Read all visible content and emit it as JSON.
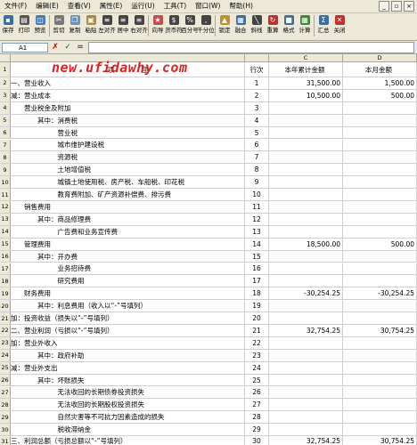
{
  "menu": [
    {
      "label": "文件(F)",
      "name": "menu-file"
    },
    {
      "label": "编辑(E)",
      "name": "menu-edit"
    },
    {
      "label": "查看(V)",
      "name": "menu-view"
    },
    {
      "label": "属性(E)",
      "name": "menu-properties"
    },
    {
      "label": "运行(U)",
      "name": "menu-run"
    },
    {
      "label": "工具(T)",
      "name": "menu-tools"
    },
    {
      "label": "窗口(W)",
      "name": "menu-window"
    },
    {
      "label": "帮助(H)",
      "name": "menu-help"
    }
  ],
  "toolbar": [
    {
      "label": "保存",
      "name": "save-button",
      "icon": "save-icon",
      "color": "#3a6ea5"
    },
    {
      "label": "打印",
      "name": "print-button",
      "icon": "printer-icon",
      "color": "#555555"
    },
    {
      "label": "预览",
      "name": "preview-button",
      "icon": "preview-icon",
      "color": "#4a7ab0"
    },
    {
      "sep": true
    },
    {
      "label": "剪切",
      "name": "cut-button",
      "icon": "scissors-icon",
      "color": "#777777"
    },
    {
      "label": "复制",
      "name": "copy-button",
      "icon": "copy-icon",
      "color": "#6a8fc0"
    },
    {
      "label": "粘贴",
      "name": "paste-button",
      "icon": "paste-icon",
      "color": "#b08a3a"
    },
    {
      "label": "左对齐",
      "name": "align-left-button",
      "icon": "align-left-icon",
      "color": "#444444"
    },
    {
      "label": "居中",
      "name": "align-center-button",
      "icon": "align-center-icon",
      "color": "#444444"
    },
    {
      "label": "右对齐",
      "name": "align-right-button",
      "icon": "align-right-icon",
      "color": "#444444"
    },
    {
      "sep": true
    },
    {
      "label": "向导",
      "name": "wizard-button",
      "icon": "wizard-icon",
      "color": "#c05050"
    },
    {
      "label": "货币符",
      "name": "currency-button",
      "icon": "currency-icon",
      "color": "#444444"
    },
    {
      "label": "百分号",
      "name": "percent-button",
      "icon": "percent-icon",
      "color": "#444444"
    },
    {
      "label": "千分位",
      "name": "thousands-button",
      "icon": "thousands-icon",
      "color": "#444444"
    },
    {
      "sep": true
    },
    {
      "label": "锁定",
      "name": "lock-button",
      "icon": "lock-icon",
      "color": "#c09030"
    },
    {
      "label": "融合",
      "name": "merge-button",
      "icon": "merge-icon",
      "color": "#3a6ea5"
    },
    {
      "label": "斜线",
      "name": "diagonal-button",
      "icon": "diagonal-icon",
      "color": "#444444"
    },
    {
      "label": "重算",
      "name": "recalc-button",
      "icon": "recalc-icon",
      "color": "#c03030"
    },
    {
      "label": "格式",
      "name": "format-button",
      "icon": "format-icon",
      "color": "#3a6ea5"
    },
    {
      "label": "计算",
      "name": "calculate-button",
      "icon": "calculator-icon",
      "color": "#3a8a3a"
    },
    {
      "sep": true
    },
    {
      "label": "汇总",
      "name": "summary-button",
      "icon": "summary-icon",
      "color": "#3a6ea5"
    },
    {
      "label": "关闭",
      "name": "close-button",
      "icon": "close-icon",
      "color": "#c03030"
    }
  ],
  "formula_bar": {
    "cell_ref": "A1",
    "cancel": "✗",
    "confirm": "✓",
    "equals": "="
  },
  "columns": {
    "row_header": "",
    "C": "C",
    "D": "D"
  },
  "watermark": "new.ufidawhy.com",
  "rows": [
    {
      "n": "1",
      "a": "项　　　　目",
      "b": "行次",
      "c": "本年累计金额",
      "d": "本月金额",
      "h": true
    },
    {
      "n": "2",
      "a": "一、营业收入",
      "b": "1",
      "c": "31,500.00",
      "d": "1,500.00"
    },
    {
      "n": "3",
      "a": "减：营业成本",
      "b": "2",
      "c": "10,500.00",
      "d": "500.00"
    },
    {
      "n": "4",
      "a": "　　营业税金及附加",
      "b": "3",
      "c": "",
      "d": ""
    },
    {
      "n": "5",
      "a": "　　　　其中：消费税",
      "b": "4",
      "c": "",
      "d": ""
    },
    {
      "n": "6",
      "a": "　　　　　　　营业税",
      "b": "5",
      "c": "",
      "d": ""
    },
    {
      "n": "7",
      "a": "　　　　　　　城市维护建设税",
      "b": "6",
      "c": "",
      "d": ""
    },
    {
      "n": "8",
      "a": "　　　　　　　资源税",
      "b": "7",
      "c": "",
      "d": ""
    },
    {
      "n": "9",
      "a": "　　　　　　　土地增值税",
      "b": "8",
      "c": "",
      "d": ""
    },
    {
      "n": "10",
      "a": "　　　　　　　城镇土地使用税、房产税、车船税、印花税",
      "b": "9",
      "c": "",
      "d": ""
    },
    {
      "n": "11",
      "a": "　　　　　　　教育费附加、矿产资源补偿费、排污费",
      "b": "10",
      "c": "",
      "d": ""
    },
    {
      "n": "12",
      "a": "　　销售费用",
      "b": "11",
      "c": "",
      "d": ""
    },
    {
      "n": "13",
      "a": "　　　　其中：商品修理费",
      "b": "12",
      "c": "",
      "d": ""
    },
    {
      "n": "14",
      "a": "　　　　　　　广告费和业务宣传费",
      "b": "13",
      "c": "",
      "d": ""
    },
    {
      "n": "15",
      "a": "　　管理费用",
      "b": "14",
      "c": "18,500.00",
      "d": "500.00"
    },
    {
      "n": "16",
      "a": "　　　　其中：开办费",
      "b": "15",
      "c": "",
      "d": ""
    },
    {
      "n": "17",
      "a": "　　　　　　　业务招待费",
      "b": "16",
      "c": "",
      "d": ""
    },
    {
      "n": "18",
      "a": "　　　　　　　研究费用",
      "b": "17",
      "c": "",
      "d": ""
    },
    {
      "n": "19",
      "a": "　　财务费用",
      "b": "18",
      "c": "-30,254.25",
      "d": "-30,254.25"
    },
    {
      "n": "20",
      "a": "　　　　其中：利息费用（收入以“-”号填列）",
      "b": "19",
      "c": "",
      "d": ""
    },
    {
      "n": "21",
      "a": "加：投资收益（损失以“-”号填列）",
      "b": "20",
      "c": "",
      "d": ""
    },
    {
      "n": "22",
      "a": "二、营业利润（亏损以“-”号填列）",
      "b": "21",
      "c": "32,754.25",
      "d": "30,754.25"
    },
    {
      "n": "23",
      "a": "加：营业外收入",
      "b": "22",
      "c": "",
      "d": ""
    },
    {
      "n": "24",
      "a": "　　　　其中：政府补助",
      "b": "23",
      "c": "",
      "d": ""
    },
    {
      "n": "25",
      "a": "减：营业外支出",
      "b": "24",
      "c": "",
      "d": ""
    },
    {
      "n": "26",
      "a": "　　　　其中：坏账损失",
      "b": "25",
      "c": "",
      "d": ""
    },
    {
      "n": "27",
      "a": "　　　　　　　无法收回的长期债券投资损失",
      "b": "26",
      "c": "",
      "d": ""
    },
    {
      "n": "28",
      "a": "　　　　　　　无法收回的长期股权投资损失",
      "b": "27",
      "c": "",
      "d": ""
    },
    {
      "n": "29",
      "a": "　　　　　　　自然灾害等不可抗力因素造成的损失",
      "b": "28",
      "c": "",
      "d": ""
    },
    {
      "n": "30",
      "a": "　　　　　　　税收滞纳金",
      "b": "29",
      "c": "",
      "d": ""
    },
    {
      "n": "31",
      "a": "三、利润总额（亏损总额以“-”号填列）",
      "b": "30",
      "c": "32,754.25",
      "d": "30,754.25"
    }
  ]
}
